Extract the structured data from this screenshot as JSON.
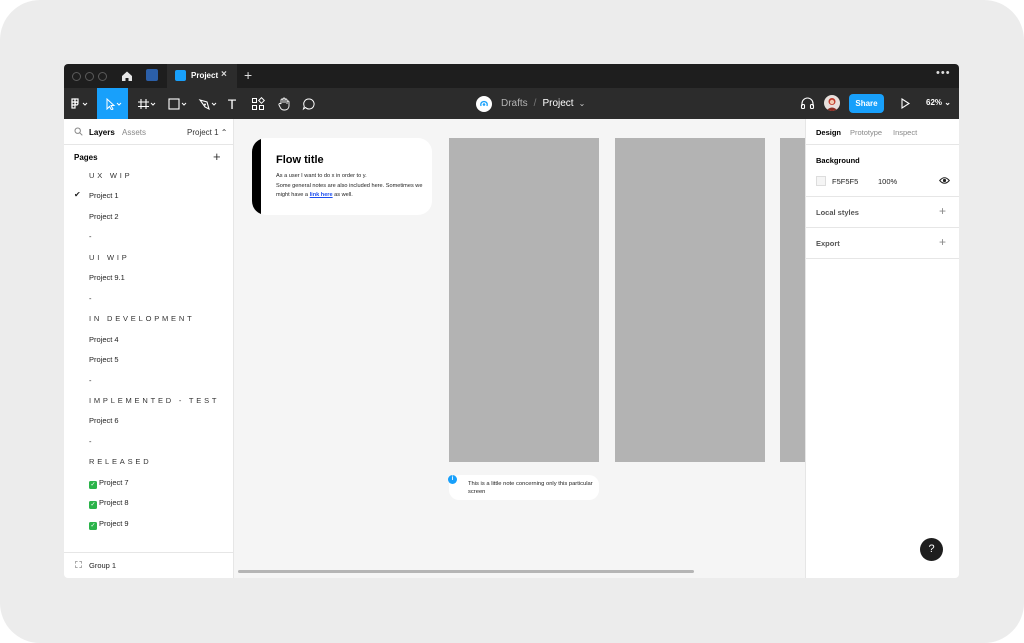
{
  "tabbar": {
    "active_tab_label": "Project",
    "close_glyph": "×",
    "add_glyph": "+",
    "more_glyph": "•••"
  },
  "toolbar": {
    "breadcrumb_drafts": "Drafts",
    "breadcrumb_sep": "/",
    "breadcrumb_project": "Project",
    "breadcrumb_caret": "⌄",
    "share_label": "Share",
    "zoom_label": "62% ⌄",
    "text_tool_glyph": "T"
  },
  "left_panel": {
    "tab_layers": "Layers",
    "tab_assets": "Assets",
    "page_selector": "Project 1 ⌃",
    "pages_heading": "Pages",
    "pages_add": "+",
    "pages": [
      {
        "label": "UX WIP",
        "kind": "section"
      },
      {
        "label": "Project 1",
        "kind": "page",
        "current": true
      },
      {
        "label": "Project 2",
        "kind": "page"
      },
      {
        "label": "-",
        "kind": "separator"
      },
      {
        "label": "UI WIP",
        "kind": "section"
      },
      {
        "label": "Project 9.1",
        "kind": "page"
      },
      {
        "label": "-",
        "kind": "separator"
      },
      {
        "label": "IN DEVELOPMENT",
        "kind": "section"
      },
      {
        "label": "Project 4",
        "kind": "page"
      },
      {
        "label": "Project 5",
        "kind": "page"
      },
      {
        "label": "-",
        "kind": "separator"
      },
      {
        "label": "IMPLEMENTED - TEST",
        "kind": "section"
      },
      {
        "label": "Project 6",
        "kind": "page"
      },
      {
        "label": "-",
        "kind": "separator"
      },
      {
        "label": "RELEASED",
        "kind": "section"
      },
      {
        "label": "Project 7",
        "kind": "page",
        "done": true
      },
      {
        "label": "Project 8",
        "kind": "page",
        "done": true
      },
      {
        "label": "Project 9",
        "kind": "page",
        "done": true
      }
    ],
    "current_check": "✔",
    "done_glyph": "✓",
    "layer_item": "Group 1"
  },
  "canvas": {
    "flow_title": "Flow title",
    "flow_line1": "As a user I want to do x in order to y.",
    "flow_line2": "Some general notes are also included here. Sometimes we might have a",
    "flow_link": "link here",
    "flow_line3": "as well.",
    "note_text": "This is a little note concerning only this particular screen",
    "note_info_glyph": "i"
  },
  "right_panel": {
    "tab_design": "Design",
    "tab_prototype": "Prototype",
    "tab_inspect": "Inspect",
    "background_heading": "Background",
    "background_hex": "F5F5F5",
    "background_opacity": "100%",
    "local_styles": "Local styles",
    "export": "Export",
    "plus": "+"
  },
  "help_glyph": "?",
  "colors": {
    "accent": "#18a0fb",
    "toolbar_bg": "#2c2c2c",
    "tabbar_bg": "#1e1e1e",
    "canvas_bg": "#F5F5F5",
    "frame_fill": "#b3b3b3",
    "link": "#1c4ef0"
  }
}
